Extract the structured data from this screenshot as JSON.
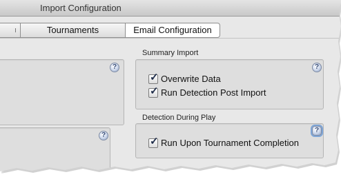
{
  "window": {
    "title": "Import Configuration"
  },
  "tabs": {
    "first_label": "",
    "tournaments_label": "Tournaments",
    "email_label": "Email Configuration"
  },
  "summary_import": {
    "label": "Summary Import",
    "options": [
      {
        "label": "Overwrite Data",
        "checked": true
      },
      {
        "label": "Run Detection Post Import",
        "checked": true
      }
    ]
  },
  "detection_during_play": {
    "label": "Detection During Play",
    "options": [
      {
        "label": "Run Upon Tournament Completion",
        "checked": true
      }
    ]
  },
  "help_glyph": "?",
  "check_glyph": "✓",
  "colors": {
    "group_bg": "#dedede",
    "window_bg": "#e8e8e8",
    "help_blue": "#8fa3c6"
  }
}
